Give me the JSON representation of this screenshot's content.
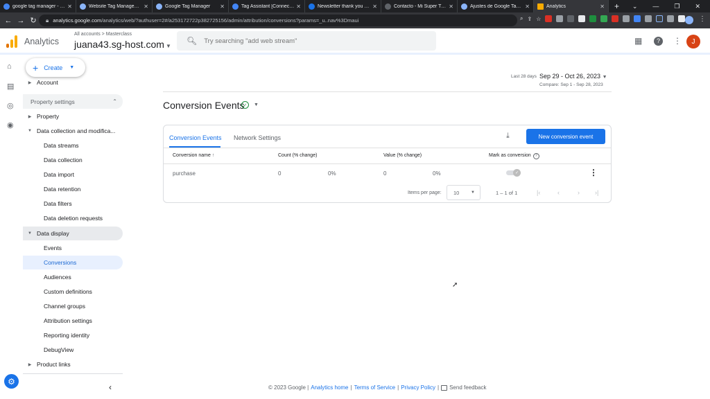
{
  "browser": {
    "tabs": [
      {
        "title": "google tag manager - Go",
        "color": "#4285f4",
        "active": false
      },
      {
        "title": "Website Tag Managemen",
        "color": "#8ab4f8",
        "active": false
      },
      {
        "title": "Google Tag Manager",
        "color": "#8ab4f8",
        "active": false
      },
      {
        "title": "Tag Assistant [Connected]",
        "color": "#4285f4",
        "active": false
      },
      {
        "title": "Newsletter thank you - M",
        "color": "#1a73e8",
        "active": false
      },
      {
        "title": "Contacto - Mi Super Tien",
        "color": "#202124",
        "active": false
      },
      {
        "title": "Ajustes de Google Tag M",
        "color": "#8ab4f8",
        "active": false
      },
      {
        "title": "Analytics",
        "color": "#f9ab00",
        "active": true
      }
    ],
    "url_host": "analytics.google.com",
    "url_path": "/analytics/web/?authuser=2#/a253172722p382725156/admin/attribution/conversions?params=_u..nav%3Dmaui"
  },
  "header": {
    "app_name": "Analytics",
    "breadcrumb": "All accounts > Masterclass",
    "property": "juana43.sg-host.com",
    "search_placeholder": "Try searching \"add web stream\"",
    "avatar_letter": "J"
  },
  "sidenav": {
    "create_label": "Create",
    "account_label": "Account",
    "section_label": "Property settings",
    "property_label": "Property",
    "data_collection_label": "Data collection and modifica...",
    "data_collection_items": [
      "Data streams",
      "Data collection",
      "Data import",
      "Data retention",
      "Data filters",
      "Data deletion requests"
    ],
    "data_display_label": "Data display",
    "data_display_items": [
      "Events",
      "Conversions",
      "Audiences",
      "Custom definitions",
      "Channel groups",
      "Attribution settings",
      "Reporting identity",
      "DebugView"
    ],
    "product_links_label": "Product links"
  },
  "main": {
    "date_label": "Last 28 days",
    "date_range": "Sep 29 - Oct 26, 2023",
    "compare_text": "Compare: Sep 1 - Sep 28, 2023",
    "page_title": "Conversion Events",
    "tabs": [
      "Conversion Events",
      "Network Settings"
    ],
    "new_button": "New conversion event",
    "columns": [
      "Conversion name",
      "Count (% change)",
      "Value (% change)",
      "Mark as conversion"
    ],
    "rows": [
      {
        "name": "purchase",
        "count": "0",
        "count_change": "0%",
        "value": "0",
        "value_change": "0%",
        "marked": true
      }
    ],
    "items_per_page_label": "Items per page:",
    "items_per_page": "10",
    "page_range": "1 – 1 of 1"
  },
  "footer": {
    "copyright": "© 2023 Google |",
    "links": [
      "Analytics home",
      "Terms of Service",
      "Privacy Policy"
    ],
    "feedback": "Send feedback"
  },
  "colors": {
    "accent": "#1a73e8",
    "active_nav_bg": "#e8f0fe",
    "check_green": "#1e8e3e"
  }
}
